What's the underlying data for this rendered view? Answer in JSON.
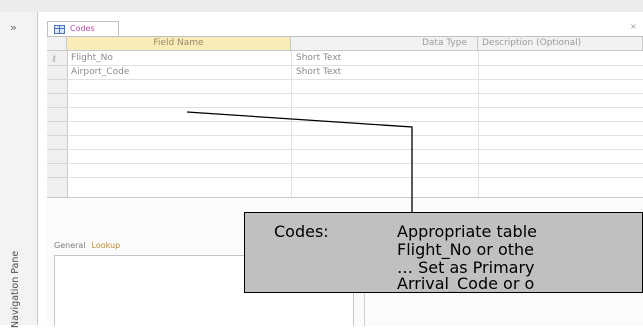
{
  "document_tab": {
    "label": "Codes"
  },
  "navigation_pane": {
    "label": "Navigation Pane",
    "toggle_glyph": "»"
  },
  "grid": {
    "headers": {
      "field_name": "Field Name",
      "data_type": "Data Type",
      "description": "Description (Optional)"
    },
    "rows": [
      {
        "field_name": "Flight_No",
        "data_type": "Short Text"
      },
      {
        "field_name": "Airport_Code",
        "data_type": "Short Text"
      }
    ]
  },
  "properties": {
    "tab_general": "General",
    "tab_lookup": "Lookup"
  },
  "callout": {
    "label": "Codes:",
    "lines": [
      "Appropriate table",
      "Flight_No or othe",
      "… Set as Primary",
      "Arrival_Code or o"
    ]
  },
  "colors": {
    "field_name_header_bg": "#f8ecb8",
    "callout_bg": "#c0c0c0",
    "tab_text": "#b54ca8"
  }
}
